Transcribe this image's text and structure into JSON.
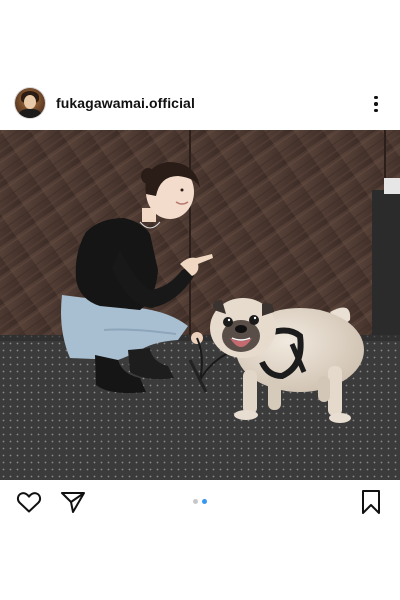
{
  "post": {
    "username": "fukagawamai.official",
    "avatar_icon": "profile-avatar",
    "more_icon": "three-dots-vertical-icon"
  },
  "image": {
    "description_icon": "photo-woman-with-pug",
    "colors": {
      "wall": "#4b3830",
      "floor": "#3a3a3a",
      "accent": "#3897f0"
    }
  },
  "actions": {
    "like_icon": "heart-icon",
    "share_icon": "paper-plane-icon",
    "save_icon": "bookmark-icon"
  },
  "carousel": {
    "count": 2,
    "active_index": 2,
    "active_color": "#3897f0",
    "inactive_color": "#c7c7c7"
  }
}
